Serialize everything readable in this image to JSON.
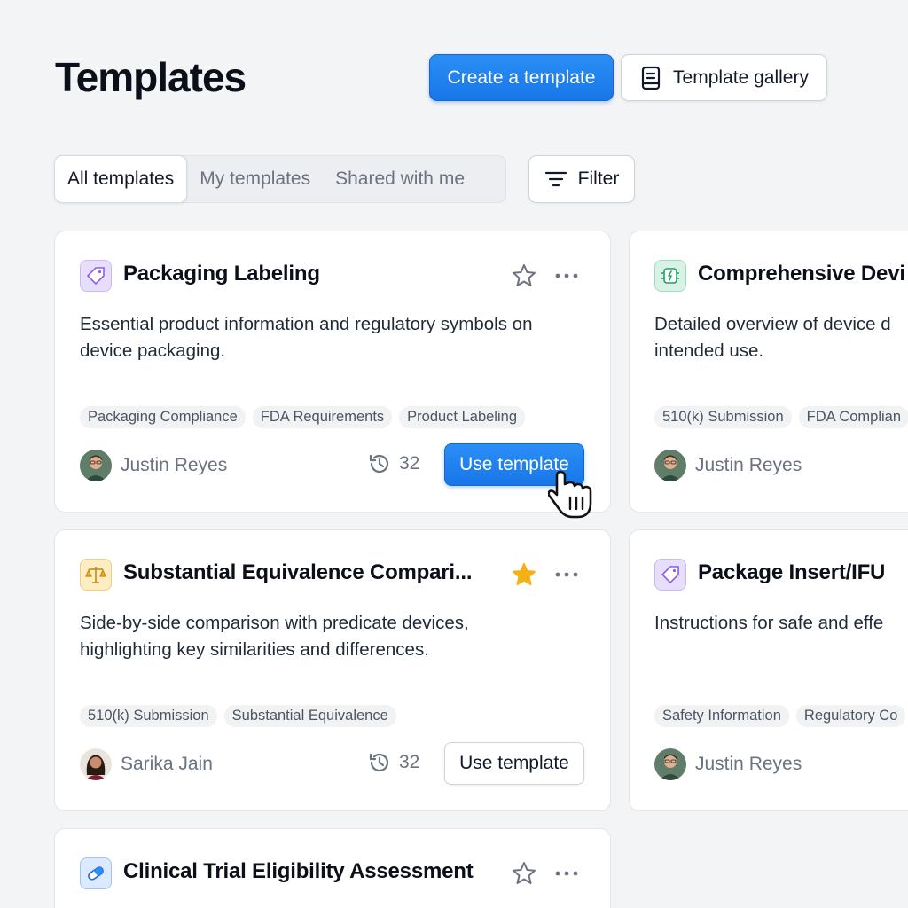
{
  "header": {
    "title": "Templates",
    "create_label": "Create a template",
    "gallery_label": "Template gallery"
  },
  "tabs": [
    {
      "label": "All templates",
      "active": true
    },
    {
      "label": "My templates",
      "active": false
    },
    {
      "label": "Shared with me",
      "active": false
    }
  ],
  "filter_label": "Filter",
  "cards": [
    {
      "title": "Packaging Labeling",
      "icon": "tag-icon",
      "starred": false,
      "description": "Essential product information and regulatory symbols on\ndevice packaging.",
      "tags": [
        "Packaging Compliance",
        "FDA Requirements",
        "Product Labeling"
      ],
      "author": "Justin Reyes",
      "uses": "32",
      "use_label": "Use template"
    },
    {
      "title": "Comprehensive Devi",
      "icon": "device-icon",
      "description": "Detailed overview of device d\nintended use.",
      "tags": [
        "510(k) Submission",
        "FDA Complian"
      ],
      "author": "Justin Reyes"
    },
    {
      "title": "Substantial Equivalence Compari...",
      "icon": "scale-icon",
      "starred": true,
      "description": "Side-by-side comparison with predicate devices,\nhighlighting key similarities and differences.",
      "tags": [
        "510(k) Submission",
        "Substantial Equivalence"
      ],
      "author": "Sarika Jain",
      "uses": "32",
      "use_label": "Use template"
    },
    {
      "title": "Package Insert/IFU",
      "icon": "tag-icon",
      "description": "Instructions for safe and effe",
      "tags": [
        "Safety Information",
        "Regulatory Co"
      ],
      "author": "Justin Reyes"
    },
    {
      "title": "Clinical Trial Eligibility Assessment",
      "icon": "pill-icon",
      "starred": false
    }
  ],
  "colors": {
    "accent": "#1877e8",
    "star_filled": "#f5b014",
    "background": "#f3f4f6"
  }
}
